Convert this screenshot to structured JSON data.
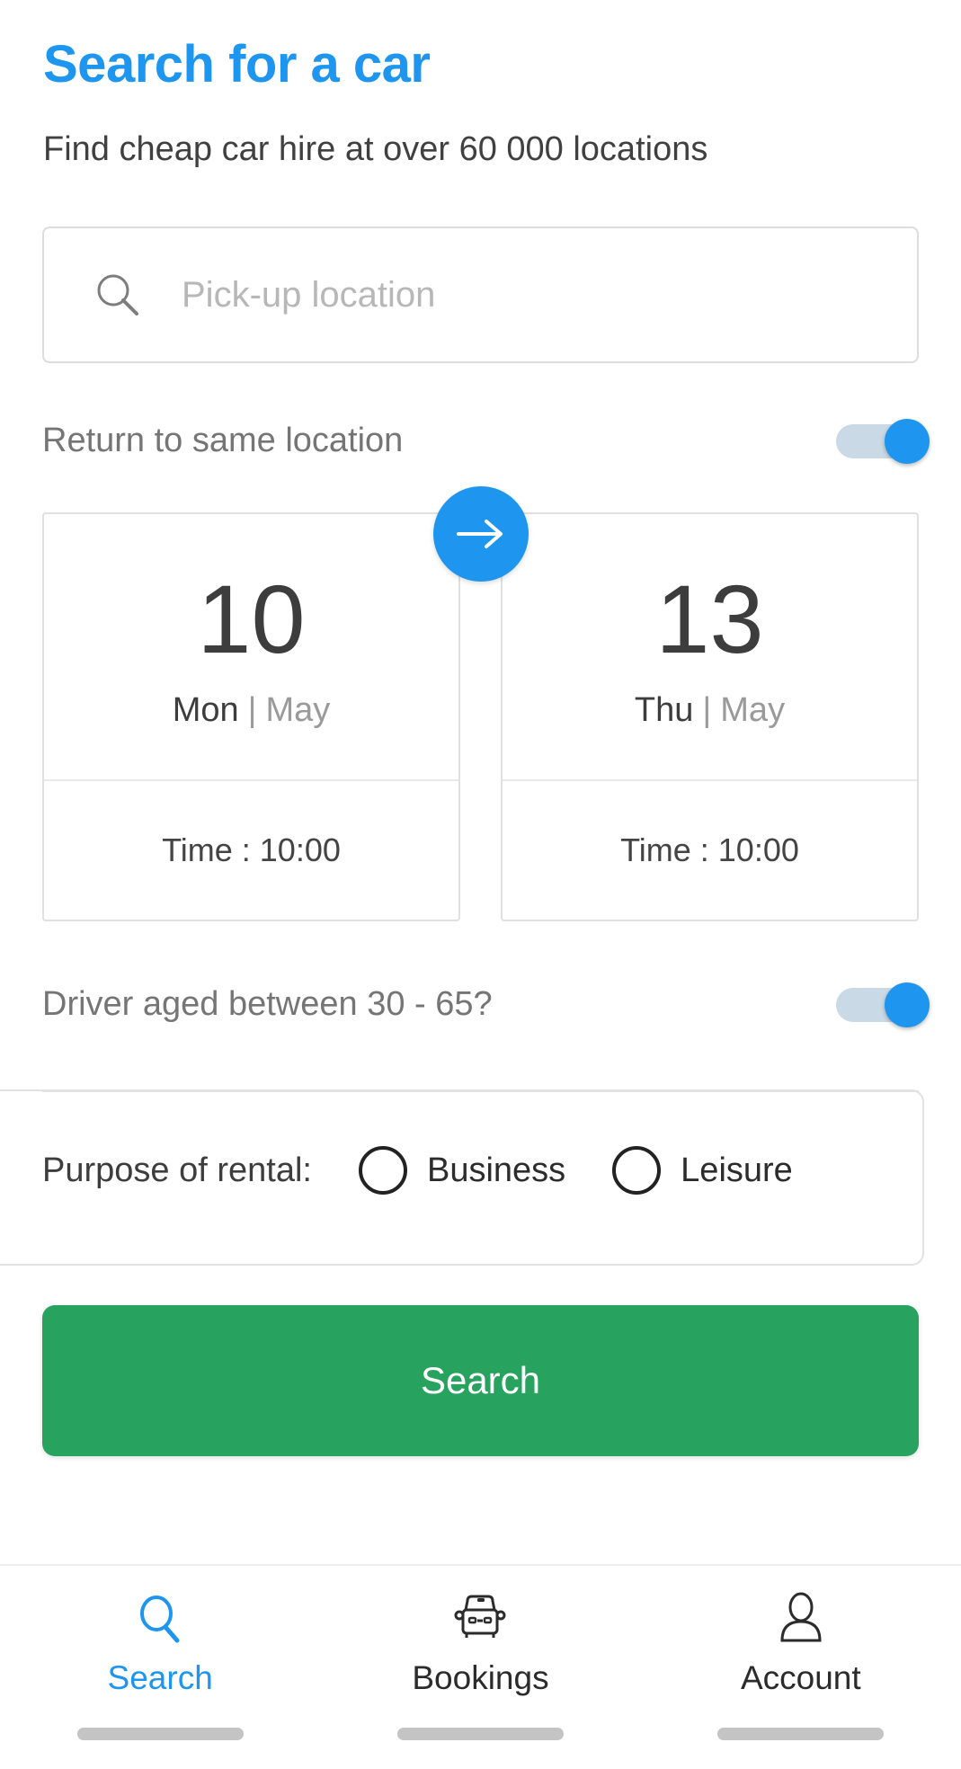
{
  "header": {
    "title": "Search for a car",
    "subtitle": "Find cheap car hire at over 60 000 locations",
    "title_color": "#1e96f0"
  },
  "pickup": {
    "icon": "search-icon",
    "placeholder": "Pick-up location",
    "value": ""
  },
  "return_toggle": {
    "label": "Return to same location",
    "state": "on",
    "accent_color": "#1e96f0"
  },
  "dates": {
    "pickup": {
      "day_number": "10",
      "weekday": "Mon",
      "separator": "|",
      "month": "May",
      "time_label": "Time : 10:00"
    },
    "dropoff": {
      "day_number": "13",
      "weekday": "Thu",
      "separator": "|",
      "month": "May",
      "time_label": "Time : 10:00"
    },
    "swap_icon": "arrow-right-icon"
  },
  "age_toggle": {
    "label": "Driver aged between 30 - 65?",
    "state": "on",
    "accent_color": "#1e96f0"
  },
  "purpose": {
    "label": "Purpose of rental:",
    "options": [
      {
        "label": "Business",
        "selected": false
      },
      {
        "label": "Leisure",
        "selected": false
      }
    ]
  },
  "submit": {
    "label": "Search",
    "color": "#28a35f"
  },
  "bottom_nav": {
    "items": [
      {
        "label": "Search",
        "icon": "search-icon",
        "active": true
      },
      {
        "label": "Bookings",
        "icon": "car-icon",
        "active": false
      },
      {
        "label": "Account",
        "icon": "person-icon",
        "active": false
      }
    ]
  }
}
